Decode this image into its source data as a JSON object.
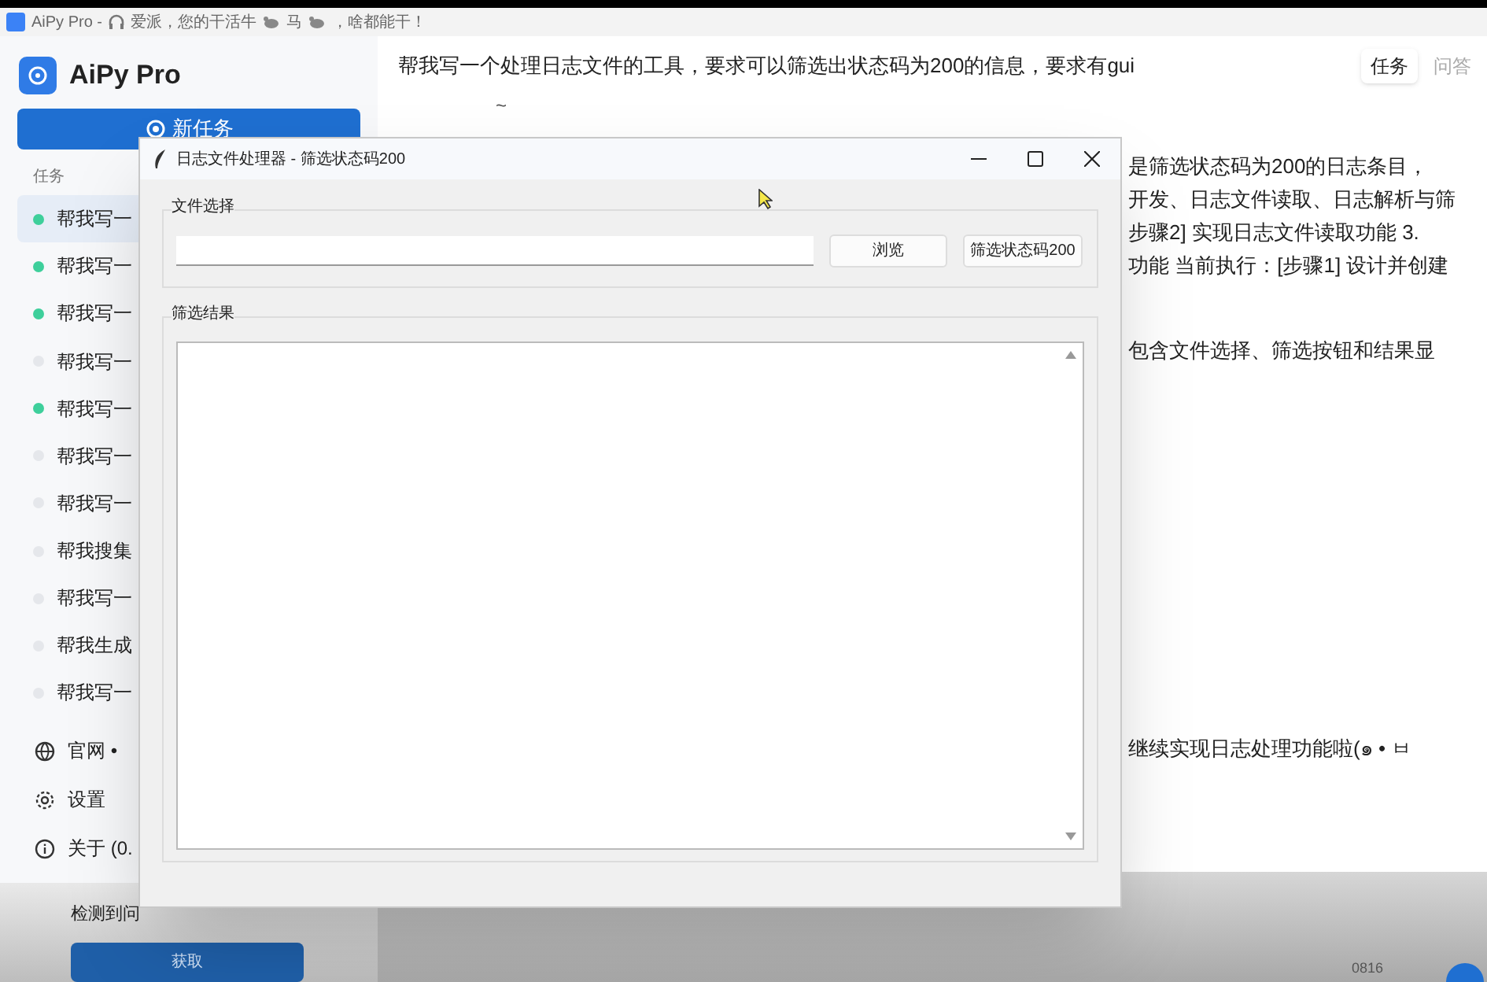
{
  "window": {
    "title_parts": [
      "AiPy Pro -",
      "爱派，您的干活牛",
      "马",
      "，啥都能干！"
    ]
  },
  "sidebar": {
    "app_name": "AiPy Pro",
    "new_task_button": "新任务",
    "section_label": "任务",
    "tasks": [
      {
        "label": "帮我写一",
        "selected": true,
        "color": "#3ecf9b"
      },
      {
        "label": "帮我写一",
        "selected": false,
        "color": "#3ecf9b"
      },
      {
        "label": "帮我写一",
        "selected": false,
        "color": "#3ecf9b"
      },
      {
        "label": "帮我写一",
        "selected": false,
        "color": "#e5e7eb"
      },
      {
        "label": "帮我写一",
        "selected": false,
        "color": "#3ecf9b"
      },
      {
        "label": "帮我写一",
        "selected": false,
        "color": "#e5e7eb"
      },
      {
        "label": "帮我写一",
        "selected": false,
        "color": "#e5e7eb"
      },
      {
        "label": "帮我搜集",
        "selected": false,
        "color": "#e5e7eb"
      },
      {
        "label": "帮我写一",
        "selected": false,
        "color": "#e5e7eb"
      },
      {
        "label": "帮我生成",
        "selected": false,
        "color": "#e5e7eb"
      },
      {
        "label": "帮我写一",
        "selected": false,
        "color": "#e5e7eb"
      }
    ],
    "links": [
      {
        "kind": "globe",
        "label": "官网 •"
      },
      {
        "kind": "gear",
        "label": "设置"
      },
      {
        "kind": "info",
        "label": "关于 (0."
      }
    ],
    "update": {
      "message": "检测到问",
      "button": "获取"
    }
  },
  "main": {
    "prompt": "帮我写一个处理日志文件的工具，要求可以筛选出状态码为200的信息，要求有gui",
    "tabs": [
      {
        "label": "任务",
        "selected": true
      },
      {
        "label": "问答",
        "selected": false
      }
    ],
    "tilde": "~",
    "reply_paragraphs": [
      [
        "是筛选状态码为200的日志条目，",
        "开发、日志文件读取、日志解析与筛",
        "步骤2] 实现日志文件读取功能 3.",
        "功能 当前执行：[步骤1] 设计并创建"
      ],
      [
        "包含文件选择、筛选按钮和结果显"
      ],
      [
        "继续实现日志处理功能啦(๑ • ㅂ"
      ]
    ],
    "footer": {
      "code": "0816"
    }
  },
  "dialog": {
    "title": "日志文件处理器 - 筛选状态码200",
    "file_group": {
      "label": "文件选择",
      "buttons": [
        "浏览",
        "筛选状态码200"
      ]
    },
    "results_group": {
      "label": "筛选结果"
    }
  }
}
